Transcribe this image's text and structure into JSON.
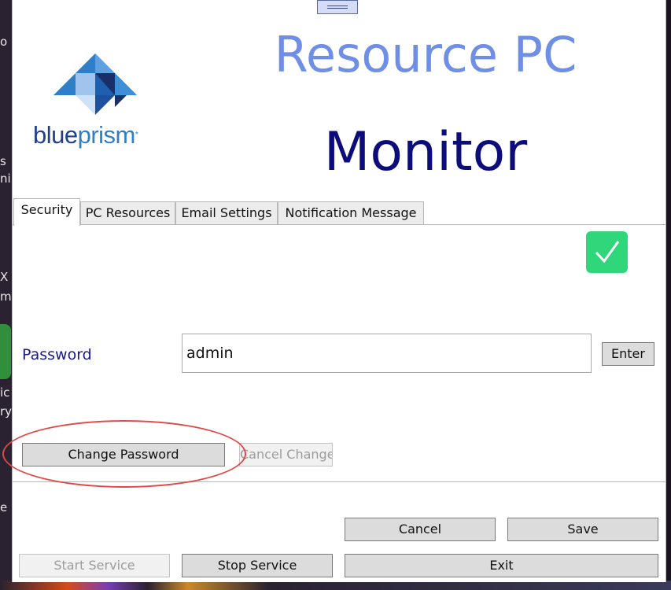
{
  "window": {
    "title_line1": "Resource PC",
    "title_line2": "Monitor"
  },
  "logo": {
    "text_part1": "blue",
    "text_part2": "prism",
    "mark": "*",
    "colors": {
      "dark": "#1f3f8f",
      "light": "#2f7fc8"
    }
  },
  "desktop_fragments": [
    "o",
    "s",
    "ni",
    "X",
    "m",
    "ic",
    "ry",
    "e"
  ],
  "tabs": [
    {
      "label": "Security",
      "active": true
    },
    {
      "label": "PC Resources",
      "active": false
    },
    {
      "label": "Email Settings",
      "active": false
    },
    {
      "label": "Notification Message",
      "active": false
    }
  ],
  "security": {
    "status_icon": "checkmark-icon",
    "status_color": "#2fd67a",
    "password_label": "Password",
    "password_value": "admin",
    "enter_label": "Enter",
    "change_password_label": "Change Password",
    "cancel_change_label": "Cancel Change"
  },
  "footer": {
    "cancel_label": "Cancel",
    "save_label": "Save",
    "start_service_label": "Start Service",
    "stop_service_label": "Stop Service",
    "exit_label": "Exit"
  },
  "colors": {
    "title_light": "#6f8fe6",
    "title_dark": "#0c0c7a",
    "annotation": "#e04848"
  }
}
